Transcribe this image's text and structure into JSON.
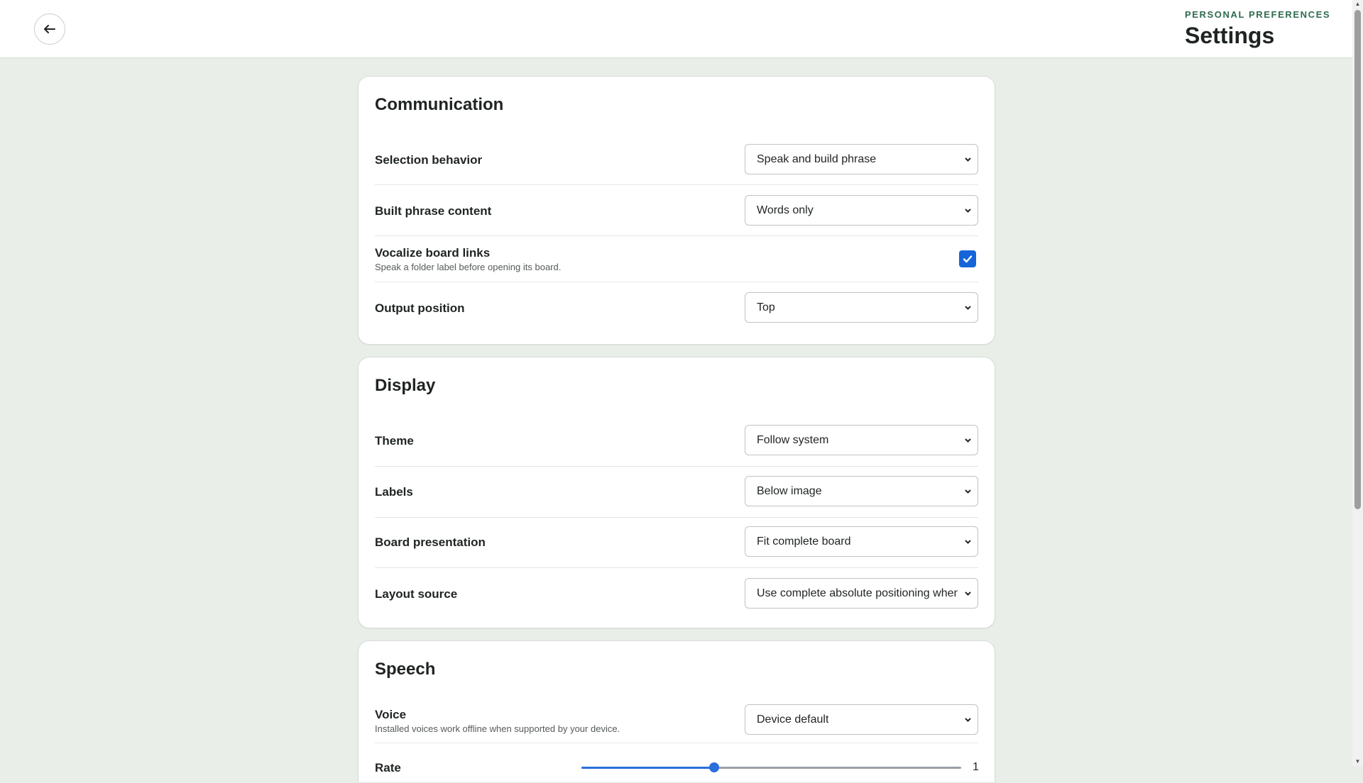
{
  "header": {
    "eyebrow": "PERSONAL PREFERENCES",
    "title": "Settings",
    "back_icon": "arrow-left-icon"
  },
  "communication": {
    "title": "Communication",
    "selection_behavior": {
      "label": "Selection behavior",
      "value": "Speak and build phrase"
    },
    "built_phrase": {
      "label": "Built phrase content",
      "value": "Words only"
    },
    "vocalize_links": {
      "label": "Vocalize board links",
      "description": "Speak a folder label before opening its board.",
      "checked": true
    },
    "output_position": {
      "label": "Output position",
      "value": "Top"
    }
  },
  "display": {
    "title": "Display",
    "theme": {
      "label": "Theme",
      "value": "Follow system"
    },
    "labels": {
      "label": "Labels",
      "value": "Below image"
    },
    "board_presentation": {
      "label": "Board presentation",
      "value": "Fit complete board"
    },
    "layout_source": {
      "label": "Layout source",
      "value": "Use complete absolute positioning when supported"
    }
  },
  "speech": {
    "title": "Speech",
    "voice": {
      "label": "Voice",
      "description": "Installed voices work offline when supported by your device.",
      "value": "Device default"
    },
    "rate": {
      "label": "Rate",
      "value": "1",
      "level_fraction": 0.35
    }
  },
  "colors": {
    "accent": "#1565d8",
    "eyebrow": "#2f6a4f",
    "background": "#e9eee9"
  }
}
